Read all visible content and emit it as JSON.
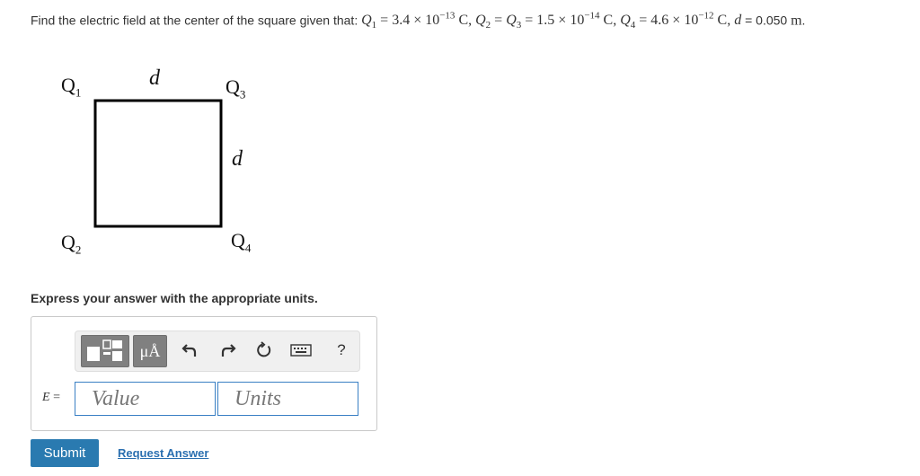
{
  "problem": {
    "prefix": "Find the electric field at the center of the square given that: ",
    "q1_sym": "Q",
    "q1_sub": "1",
    "q1_val": " = 3.4 × 10",
    "q1_exp": "−13",
    "q1_unit": " C, ",
    "q2_sym": "Q",
    "q2_sub": "2",
    "q2_eq": " = ",
    "q3_sym": "Q",
    "q3_sub": "3",
    "q3_val": " = 1.5 × 10",
    "q3_exp": "−14",
    "q3_unit": " C, ",
    "q4_sym": "Q",
    "q4_sub": "4",
    "q4_val": " = 4.6 × 10",
    "q4_exp": "−12",
    "q4_unit": " C, ",
    "d_sym": "d",
    "d_eq": " = 0.050 ",
    "d_unit": "m",
    "d_end": "."
  },
  "figure": {
    "q1": "Q",
    "q1_sub": "1",
    "q2": "Q",
    "q2_sub": "2",
    "q3": "Q",
    "q3_sub": "3",
    "q4": "Q",
    "q4_sub": "4",
    "top_side": "d",
    "right_side": "d"
  },
  "instruction": "Express your answer with the appropriate units.",
  "toolbar": {
    "units_label": "μÅ",
    "help_label": "?",
    "icons": [
      "templates-icon",
      "units-icon",
      "undo-icon",
      "redo-icon",
      "reset-icon",
      "keyboard-icon",
      "help-icon"
    ]
  },
  "answer": {
    "var_label": "E",
    "var_eq": " =",
    "value_placeholder": "Value",
    "units_placeholder": "Units"
  },
  "submit_label": "Submit",
  "request_label": "Request Answer"
}
